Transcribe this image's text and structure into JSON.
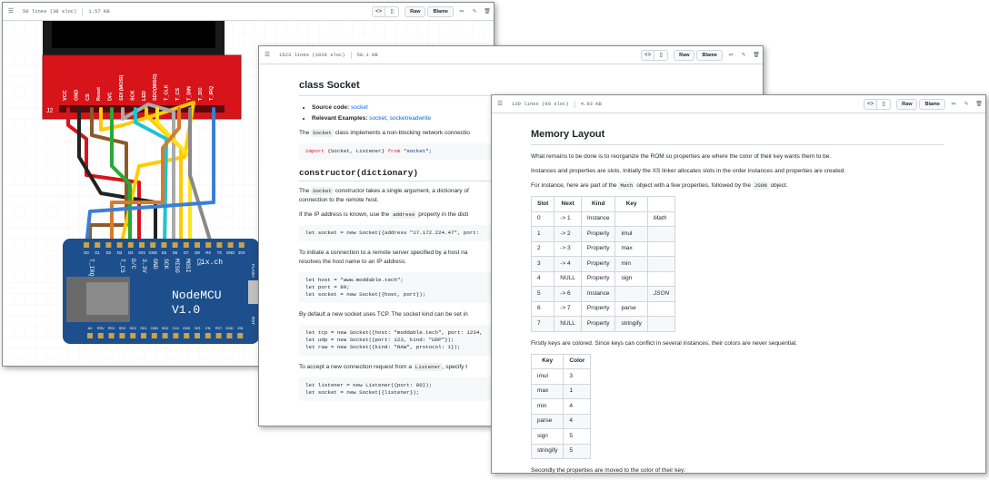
{
  "windows": [
    {
      "toolbar": {
        "lines": "50 lines (38 sloc)",
        "size": "1.57 KB",
        "raw": "Raw",
        "blame": "Blame",
        "code_glyph": "<>",
        "doc_glyph": "▯",
        "menu_glyph": "☰",
        "monitor_glyph": "▭",
        "pencil_glyph": "✎",
        "trash_glyph": "🗑"
      },
      "diagram": {
        "tft_pins": [
          "VCC",
          "GND",
          "CS",
          "Reset",
          "D/C",
          "SDI (MOSI)",
          "SCK",
          "LED",
          "SDO(MISO)",
          "T_CLK",
          "T_CS",
          "T_DIN",
          "T_DO",
          "T_IRQ"
        ],
        "header_label": "J2",
        "mcu_top_pins": [
          "D0",
          "D1",
          "D2",
          "D3",
          "D4",
          "3V3",
          "GND",
          "D5",
          "D6",
          "D7",
          "D8",
          "RX",
          "TX",
          "GND",
          "3V3"
        ],
        "mcu_labels": [
          "T_IRQ",
          "T_CS",
          "D/C",
          "3.3V",
          "GND",
          "SCK",
          "MISO",
          "MOSI",
          "CS"
        ],
        "mcu_brand": "NodeMCU",
        "mcu_version": "V1.0",
        "mcu_site": "ix.ch",
        "mcu_flash": "FLASH",
        "mcu_rst": "RST",
        "mcu_bottom_pins": [
          "A0",
          "RSV",
          "RSV",
          "SD3",
          "SD2",
          "SD1",
          "CMD",
          "SD0",
          "CLK",
          "GND",
          "3V3",
          "EN",
          "RST",
          "GND",
          "VIN"
        ]
      }
    },
    {
      "toolbar": {
        "lines": "1523 lines (1028 sloc)",
        "size": "58.1 KB",
        "raw": "Raw",
        "blame": "Blame",
        "code_glyph": "<>",
        "doc_glyph": "▯",
        "menu_glyph": "☰",
        "monitor_glyph": "▭",
        "pencil_glyph": "✎",
        "trash_glyph": "🗑"
      },
      "title": "class Socket",
      "source_label": "Source code:",
      "source_link": "socket",
      "examples_label": "Relevant Examples:",
      "example_link_1": "socket",
      "example_sep": ", ",
      "example_link_2": "socketreadwrite",
      "p1_pre": "The",
      "p1_code": "Socket",
      "p1_post": "class implements a non-blocking network connectio",
      "import_kw": "import",
      "import_mid": " {Socket, Listener} ",
      "import_from": "from",
      "import_str": " \"socket\";",
      "ctor_title": "constructor(dictionary)",
      "p2_pre": "The",
      "p2_code": "Socket",
      "p2_post": "constructor takes a single argument, a dictionary of",
      "p2_line2": "connection to the remote host.",
      "p3_pre": "If the IP address is known, use the",
      "p3_code": "address",
      "p3_post": "property in the dicti",
      "code_addr": "let socket = new Socket({address \"17.172.224.47\", port:",
      "p4_line1": "To initiate a connection to a remote server specified by a host na",
      "p4_line2": "resolves the host name to an IP address.",
      "code_host_1": "let host = \"www.moddable.tech\";",
      "code_host_2": "let port = 80;",
      "code_host_3": "let socket = new Socket({host, port});",
      "p5": "By default a new socket uses TCP. The socket kind can be set in",
      "code_tcp_1": "let tcp = new Socket({host: \"moddable.tech\", port: 1234,",
      "code_tcp_2": "let udp = new Socket({port: 123, kind: \"UDP\"});",
      "code_tcp_3": "let raw = new Socket({kind: \"RAW\", protocol: 1});",
      "p6_pre": "To accept a new connection request from a",
      "p6_code": "Listener",
      "p6_post": ", specify t",
      "code_list_1": "let listener = new Listener({port: 80});",
      "code_list_2": "let socket = new Socket({listener});"
    },
    {
      "toolbar": {
        "lines": "130 lines (90 sloc)",
        "size": "4.93 KB",
        "raw": "Raw",
        "blame": "Blame",
        "code_glyph": "<>",
        "doc_glyph": "▯",
        "menu_glyph": "☰",
        "monitor_glyph": "▭",
        "pencil_glyph": "✎",
        "trash_glyph": "🗑"
      },
      "title": "Memory Layout",
      "p1": "What remains to be done is to reorganize the ROM so properties are where the color of their key wants them to be.",
      "p2": "Instances and properties are slots. Initially the XS linker allocates slots in the order instances and properties are created.",
      "p3_pre": "For instance, here are part of the",
      "p3_code1": "Math",
      "p3_mid": "object with a few properties, followed by the",
      "p3_code2": "JSON",
      "p3_post": "object.",
      "table1": {
        "headers": [
          "Slot",
          "Next",
          "Kind",
          "Key",
          ""
        ],
        "rows": [
          [
            "0",
            "-> 1",
            "Instance",
            "",
            "Math"
          ],
          [
            "1",
            "-> 2",
            "Property",
            "imul",
            ""
          ],
          [
            "2",
            "-> 3",
            "Property",
            "max",
            ""
          ],
          [
            "3",
            "-> 4",
            "Property",
            "min",
            ""
          ],
          [
            "4",
            "NULL",
            "Property",
            "sign",
            ""
          ],
          [
            "5",
            "-> 6",
            "Instance",
            "",
            "JSON"
          ],
          [
            "6",
            "-> 7",
            "Property",
            "parse",
            ""
          ],
          [
            "7",
            "NULL",
            "Property",
            "stringify",
            ""
          ]
        ]
      },
      "p4": "Firstly keys are colored. Since keys can conflict in several instances, their colors are never sequential.",
      "table2": {
        "headers": [
          "Key",
          "Color"
        ],
        "rows": [
          [
            "imul",
            "3"
          ],
          [
            "max",
            "1"
          ],
          [
            "min",
            "4"
          ],
          [
            "parse",
            "4"
          ],
          [
            "sign",
            "5"
          ],
          [
            "stringify",
            "5"
          ]
        ]
      },
      "p5": "Secondly the properties are moved to the color of their key:"
    }
  ],
  "colors": {
    "tft_board": "#d7141a",
    "mcu_board": "#1d4f8c",
    "link": "#0969da"
  }
}
